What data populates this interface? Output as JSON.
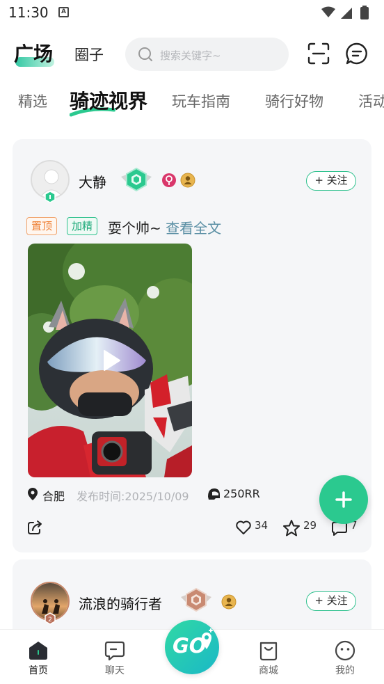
{
  "status_bar": {
    "time": "11:30",
    "notif_letter": "A"
  },
  "header": {
    "tab_square": "广场",
    "tab_circle": "圈子",
    "search_placeholder": "搜索关键字~"
  },
  "channels": [
    "精选",
    "骑迹视界",
    "玩车指南",
    "骑行好物",
    "活动"
  ],
  "active_channel_index": 1,
  "posts": [
    {
      "author": "大静",
      "follow_label": "+ 关注",
      "tag_top": "置顶",
      "tag_fine": "加精",
      "text": "耍个帅~",
      "more_link": "查看全文",
      "location": "合肥",
      "published": "发布时间:2025/10/09",
      "bike": "250RR",
      "likes": "34",
      "stars": "29",
      "comments": "7"
    },
    {
      "author": "流浪的骑行者",
      "follow_label": "+ 关注"
    }
  ],
  "bottom_nav": {
    "home": "首页",
    "chat": "聊天",
    "center": "GO",
    "mall": "商城",
    "me": "我的"
  },
  "colors": {
    "accent": "#2bc98f",
    "tag_orange": "#ee7f33",
    "link": "#5a8fa4"
  }
}
